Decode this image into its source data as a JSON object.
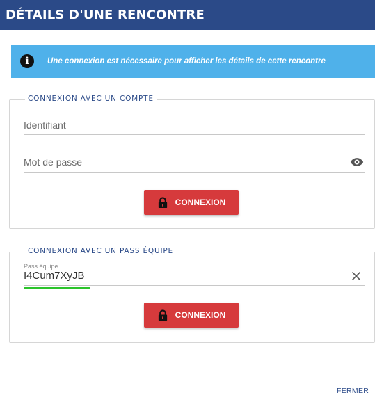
{
  "dialog": {
    "title": "DÉTAILS D'UNE RENCONTRE",
    "close_label": "FERMER"
  },
  "info": {
    "icon": "info-icon",
    "glyph": "i",
    "message": "Une connexion est nécessaire pour afficher les détails de cette rencontre",
    "color": "#4fb1ea"
  },
  "account_login": {
    "legend": "CONNEXION AVEC UN COMPTE",
    "username_placeholder": "Identifiant",
    "password_placeholder": "Mot de passe",
    "toggle_icon": "eye-icon",
    "button_icon": "lock-icon",
    "button_label": "CONNEXION"
  },
  "team_pass_login": {
    "legend": "CONNEXION AVEC UN PASS ÉQUIPE",
    "field_label": "Pass équipe",
    "field_value": "I4Cum7XyJB",
    "clear_icon": "close-icon",
    "button_icon": "lock-icon",
    "button_label": "CONNEXION"
  },
  "colors": {
    "header": "#2b4a88",
    "button": "#d63a3c",
    "highlight": "#2bc42b"
  }
}
